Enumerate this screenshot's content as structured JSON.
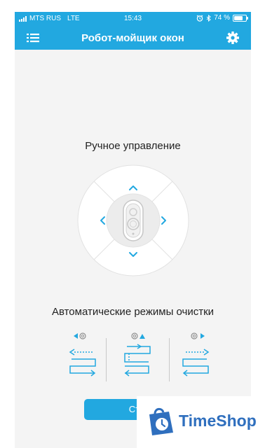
{
  "status_bar": {
    "carrier": "MTS RUS",
    "network": "LTE",
    "time": "15:43",
    "battery": "74 %",
    "battery_level": 0.74
  },
  "header": {
    "title": "Робот-мойщик окон",
    "menu_icon": "list-menu-icon",
    "settings_icon": "gear-icon"
  },
  "manual": {
    "title": "Ручное управление",
    "controls": [
      "arrow-up",
      "arrow-down",
      "arrow-left",
      "arrow-right"
    ],
    "center_icon": "robot-icon"
  },
  "auto": {
    "title": "Автоматические режимы очистки",
    "modes": [
      "mode-left-icon",
      "mode-up-icon",
      "mode-right-icon"
    ]
  },
  "start_button": {
    "label": "Ста"
  },
  "watermark": {
    "text": "TimeShop",
    "icon": "timeshop-logo-icon"
  },
  "colors": {
    "accent": "#22a8e0",
    "background": "#f4f4f4",
    "watermark": "#2f6fbe"
  }
}
